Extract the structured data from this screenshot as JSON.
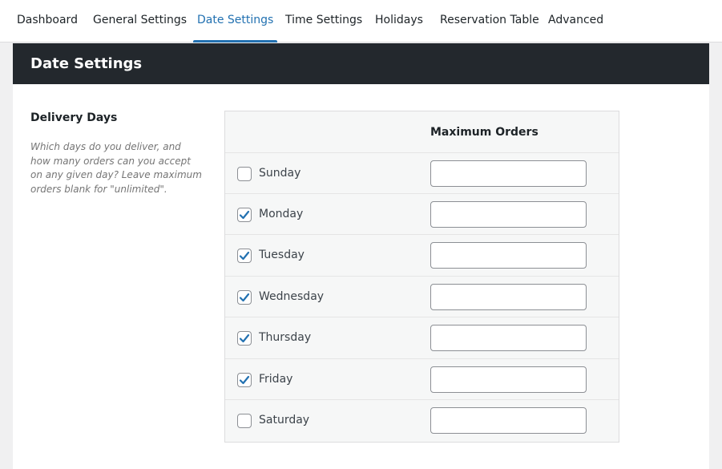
{
  "tabs": [
    {
      "label": "Dashboard",
      "active": false
    },
    {
      "label": "General Settings",
      "active": false
    },
    {
      "label": "Date Settings",
      "active": true
    },
    {
      "label": "Time Settings",
      "active": false
    },
    {
      "label": "Holidays",
      "active": false
    },
    {
      "label": "Reservation Table",
      "active": false
    },
    {
      "label": "Advanced",
      "active": false
    }
  ],
  "panel": {
    "title": "Date Settings"
  },
  "delivery_days": {
    "title": "Delivery Days",
    "description": "Which days do you deliver, and how many orders can you accept on any given day? Leave maximum orders blank for \"unlimited\".",
    "column_header": "Maximum Orders",
    "days": [
      {
        "name": "Sunday",
        "checked": false,
        "max_orders": ""
      },
      {
        "name": "Monday",
        "checked": true,
        "max_orders": ""
      },
      {
        "name": "Tuesday",
        "checked": true,
        "max_orders": ""
      },
      {
        "name": "Wednesday",
        "checked": true,
        "max_orders": ""
      },
      {
        "name": "Thursday",
        "checked": true,
        "max_orders": ""
      },
      {
        "name": "Friday",
        "checked": true,
        "max_orders": ""
      },
      {
        "name": "Saturday",
        "checked": false,
        "max_orders": ""
      }
    ]
  },
  "colors": {
    "accent": "#2271b1",
    "header_bg": "#23282d",
    "page_bg": "#f0f0f1"
  },
  "icons": {
    "checkbox_checked": "checkmark-icon"
  }
}
